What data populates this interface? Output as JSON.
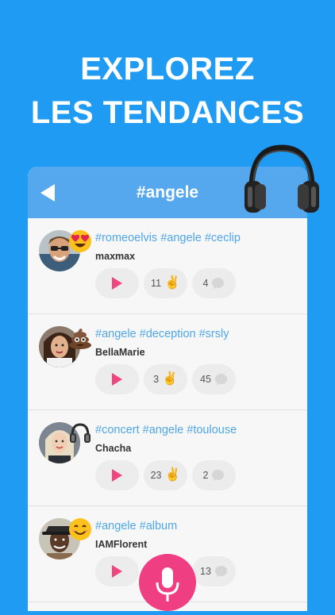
{
  "headline": {
    "line1": "EXPLOREZ",
    "line2": "LES TENDANCES"
  },
  "header": {
    "title": "#angele",
    "back_icon": "back-arrow-icon"
  },
  "colors": {
    "background": "#1f9bf3",
    "header": "#55a8ee",
    "accent": "#f0457f",
    "tags": "#4fa6e8"
  },
  "posts": [
    {
      "tags": "#romeoelvis #angele #ceclip",
      "user": "maxmax",
      "likes": "11",
      "comments": "4",
      "emoji": "heart-eyes-emoji"
    },
    {
      "tags": "#angele #deception #srsly",
      "user": "BellaMarie",
      "likes": "3",
      "comments": "45",
      "emoji": "poop-emoji"
    },
    {
      "tags": "#concert #angele #toulouse",
      "user": "Chacha",
      "likes": "23",
      "comments": "2",
      "emoji": "headphones-emoji"
    },
    {
      "tags": "#angele #album",
      "user": "IAMFlorent",
      "likes": "",
      "comments": "13",
      "emoji": "smile-emoji"
    }
  ]
}
